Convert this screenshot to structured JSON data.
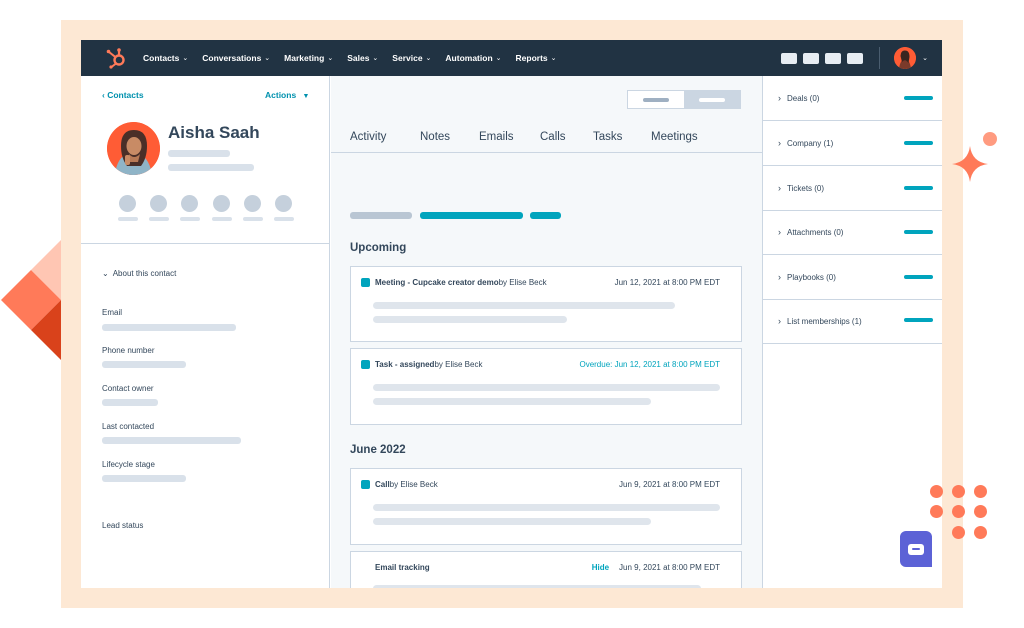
{
  "nav": {
    "items": [
      "Contacts",
      "Conversations",
      "Marketing",
      "Sales",
      "Service",
      "Automation",
      "Reports"
    ],
    "chevron": "⌄"
  },
  "contact": {
    "back_label": "Contacts",
    "actions_label": "Actions",
    "name": "Aisha Saah",
    "about_label": "About this contact",
    "fields": [
      "Email",
      "Phone number",
      "Contact owner",
      "Last contacted",
      "Lifecycle stage",
      "Lead status"
    ]
  },
  "tabs": [
    "Activity",
    "Notes",
    "Emails",
    "Calls",
    "Tasks",
    "Meetings"
  ],
  "timeline": {
    "upcoming_title": "Upcoming",
    "month_title": "June 2022",
    "cards": [
      {
        "type": "Meeting - Cupcake creator demo",
        "by": " by Elise Beck",
        "date": "Jun 12, 2021 at 8:00 PM EDT"
      },
      {
        "type": "Task - assigned",
        "by": " by Elise Beck",
        "date": "Overdue: Jun 12, 2021 at 8:00 PM EDT"
      },
      {
        "type": "Call",
        "by": " by Elise Beck",
        "date": "Jun 9, 2021 at 8:00 PM EDT"
      },
      {
        "type": "Email tracking",
        "by": "",
        "hide": "Hide",
        "date": "Jun 9, 2021 at 8:00 PM EDT"
      }
    ]
  },
  "sidebar": {
    "items": [
      "Deals (0)",
      "Company (1)",
      "Tickets (0)",
      "Attachments (0)",
      "Playbooks (0)",
      "List memberships (1)"
    ]
  },
  "colors": {
    "nav_bg": "#213343",
    "accent": "#00a4bd",
    "brand": "#ff5c35",
    "frame": "#fde8d4",
    "chat": "#5c62d6"
  },
  "icons": [
    "hubspot-logo-icon",
    "chevron-down-icon",
    "chevron-left-icon",
    "chevron-right-icon",
    "chat-icon",
    "sparkle-icon"
  ]
}
